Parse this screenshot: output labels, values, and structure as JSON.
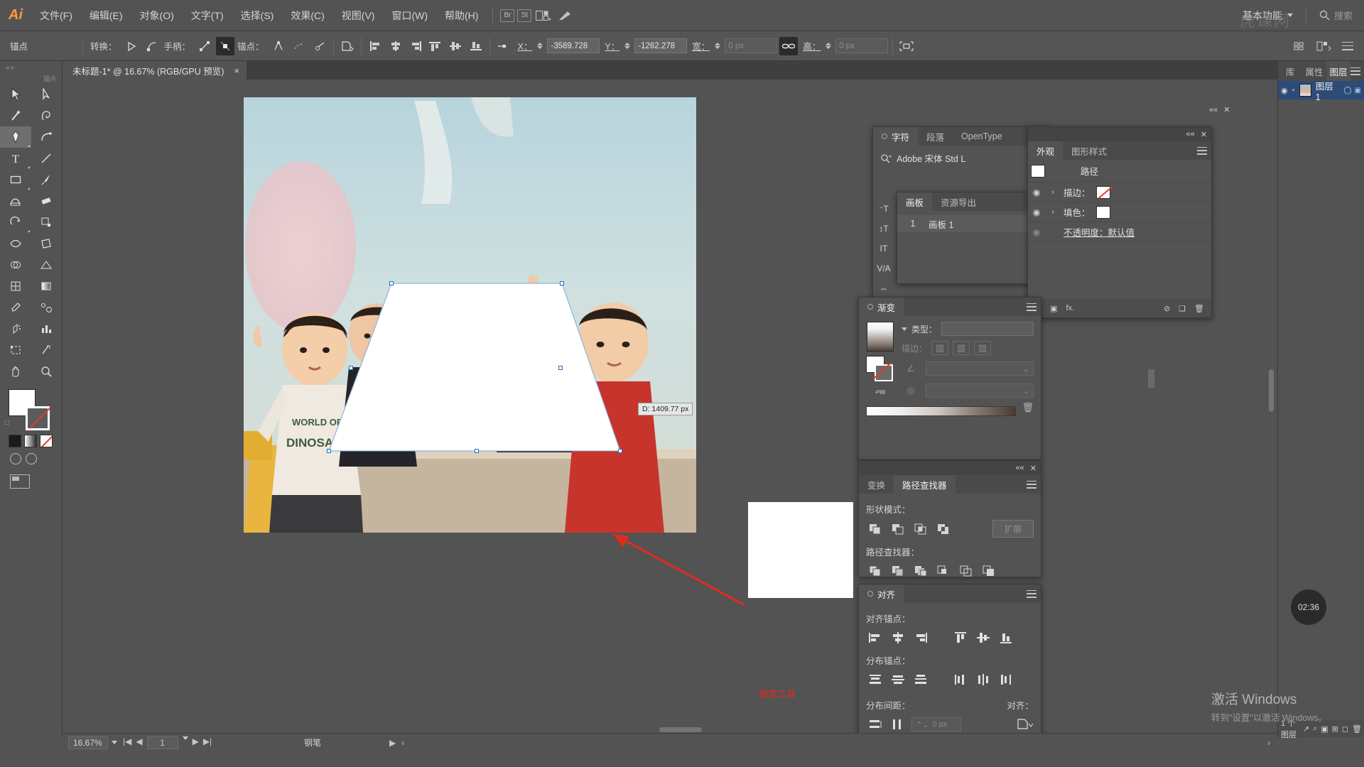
{
  "app": {
    "logo": "Ai",
    "watermark": "虎课网"
  },
  "menubar": {
    "items": [
      "文件(F)",
      "编辑(E)",
      "对象(O)",
      "文字(T)",
      "选择(S)",
      "效果(C)",
      "视图(V)",
      "窗口(W)",
      "帮助(H)"
    ],
    "br_icon": "Br",
    "st_icon": "St",
    "arrange_icon": "arrange-documents-icon",
    "behance_icon": "behance-icon",
    "workspace": "基本功能",
    "search_placeholder": "搜索"
  },
  "controlbar": {
    "label": "锚点",
    "convert_label": "转换：",
    "handles_label": "手柄：",
    "anchor_label": "锚点：",
    "x_label": "X：",
    "x_value": "-3589.728",
    "y_label": "Y：",
    "y_value": "-1262.278",
    "w_label": "宽：",
    "w_value": "0 px",
    "h_label": "高：",
    "h_value": "0 px",
    "link_icon": "link-dimensions-icon",
    "isolate_icon": "isolate-selected-icon"
  },
  "document": {
    "tab_title": "未标题-1* @ 16.67% (RGB/GPU 预览)",
    "close": "×"
  },
  "toolbar": {
    "title": "锚点",
    "tools": [
      "selection-tool",
      "direct-selection-tool",
      "magic-wand-tool",
      "lasso-tool",
      "pen-tool",
      "curvature-tool",
      "type-tool",
      "line-segment-tool",
      "rectangle-tool",
      "paintbrush-tool",
      "shaper-tool",
      "eraser-tool",
      "rotate-tool",
      "scale-tool",
      "width-tool",
      "free-transform-tool",
      "shape-builder-tool",
      "perspective-grid-tool",
      "mesh-tool",
      "gradient-tool",
      "eyedropper-tool",
      "blend-tool",
      "symbol-sprayer-tool",
      "column-graph-tool",
      "artboard-tool",
      "slice-tool",
      "hand-tool",
      "zoom-tool"
    ],
    "fill_color": "#ffffff",
    "stroke_color": "none",
    "screen_mode": "screen-mode-icon"
  },
  "canvas": {
    "dimension_tooltip": "D: 1409.77 px",
    "annotation": "钢笔工具",
    "shape_fill": "#ffffff"
  },
  "panels": {
    "character": {
      "tabs": [
        "字符",
        "段落",
        "OpenType"
      ],
      "active_tab": "字符",
      "font_family": "Adobe 宋体 Std L",
      "search_icon": "font-search-icon"
    },
    "artboards": {
      "tabs": [
        "画板",
        "资源导出"
      ],
      "active_tab": "画板",
      "rows": [
        {
          "num": "1",
          "name": "画板 1"
        }
      ]
    },
    "appearance": {
      "tabs": [
        "外观",
        "图形样式"
      ],
      "active_tab": "外观",
      "rows": [
        {
          "label": "路径",
          "type": "title"
        },
        {
          "label": "描边：",
          "type": "stroke",
          "swatch": "none"
        },
        {
          "label": "填色：",
          "type": "fill",
          "swatch": "#ffffff"
        },
        {
          "label": "不透明度：默认值",
          "type": "opacity"
        }
      ],
      "footer_icons": [
        "add-new-stroke-icon",
        "add-new-fill-icon",
        "add-new-effect-icon",
        "clear-appearance-icon",
        "duplicate-item-icon",
        "delete-item-icon"
      ]
    },
    "gradient": {
      "title": "渐变",
      "type_label": "类型：",
      "type_value": "",
      "stroke_label": "描边：",
      "angle_label": "angle-icon",
      "aspect_label": "aspect-ratio-icon",
      "delete_icon": "delete-stop-icon"
    },
    "pathfinder": {
      "tabs": [
        "变换",
        "路径查找器"
      ],
      "active_tab": "路径查找器",
      "shape_modes_label": "形状模式：",
      "expand_label": "扩展",
      "pathfinders_label": "路径查找器：",
      "shape_mode_icons": [
        "unite-icon",
        "minus-front-icon",
        "intersect-icon",
        "exclude-icon"
      ],
      "pathfinder_icons": [
        "divide-icon",
        "trim-icon",
        "merge-icon",
        "crop-icon",
        "outline-icon",
        "minus-back-icon"
      ]
    },
    "align": {
      "title": "对齐",
      "align_objects_label": "对齐锚点：",
      "distribute_objects_label": "分布锚点：",
      "distribute_spacing_label": "分布间距：",
      "align_to_label": "对齐：",
      "spacing_value": "0 px",
      "align_icons": [
        "align-left-icon",
        "align-horizontal-center-icon",
        "align-right-icon",
        "align-top-icon",
        "align-vertical-center-icon",
        "align-bottom-icon"
      ],
      "distribute_icons": [
        "distribute-top-icon",
        "distribute-vertical-center-icon",
        "distribute-bottom-icon",
        "distribute-left-icon",
        "distribute-horizontal-center-icon",
        "distribute-right-icon"
      ],
      "spacing_icons": [
        "vertical-distribute-space-icon",
        "horizontal-distribute-space-icon"
      ],
      "align_to_icon": "align-to-selection-icon"
    },
    "layers": {
      "tabs": [
        "库",
        "属性",
        "图层"
      ],
      "active_tab": "图层",
      "layer_name": "图层 1",
      "footer_count": "1 个图层",
      "footer_icons": [
        "release-to-layers-icon",
        "locate-object-icon",
        "make-clipping-mask-icon",
        "create-new-sublayer-icon",
        "create-new-layer-icon",
        "delete-selection-icon"
      ]
    }
  },
  "statusbar": {
    "zoom": "16.67%",
    "page": "1",
    "tool_name": "钢笔",
    "nav_first": "first-artboard-icon",
    "nav_prev": "previous-artboard-icon",
    "nav_next": "next-artboard-icon",
    "nav_last": "last-artboard-icon"
  },
  "overlays": {
    "timer": "02:36",
    "windows_activation_title": "激活 Windows",
    "windows_activation_sub": "转到\"设置\"以激活 Windows。"
  }
}
